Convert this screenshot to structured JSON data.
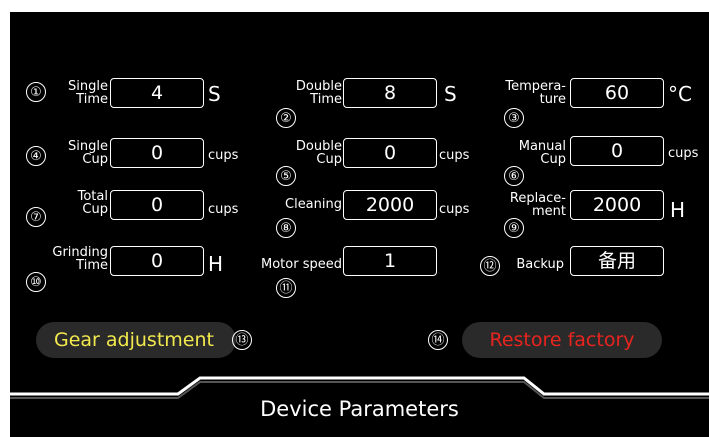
{
  "params": [
    {
      "num": "①",
      "label": [
        "Single",
        "Time"
      ],
      "value": "4",
      "unit": "S"
    },
    {
      "num": "②",
      "label": [
        "Double",
        "Time"
      ],
      "value": "8",
      "unit": "S"
    },
    {
      "num": "③",
      "label": [
        "Tempera-",
        "ture"
      ],
      "value": "60",
      "unit": "°C"
    },
    {
      "num": "④",
      "label": [
        "Single",
        "Cup"
      ],
      "value": "0",
      "unit": "cups"
    },
    {
      "num": "⑤",
      "label": [
        "Double",
        "Cup"
      ],
      "value": "0",
      "unit": "cups"
    },
    {
      "num": "⑥",
      "label": [
        "Manual",
        "Cup"
      ],
      "value": "0",
      "unit": "cups"
    },
    {
      "num": "⑦",
      "label": [
        "Total",
        "Cup"
      ],
      "value": "0",
      "unit": "cups"
    },
    {
      "num": "⑧",
      "label": [
        "Cleaning"
      ],
      "value": "2000",
      "unit": "cups"
    },
    {
      "num": "⑨",
      "label": [
        "Replace-",
        "ment"
      ],
      "value": "2000",
      "unit": "H"
    },
    {
      "num": "⑩",
      "label": [
        "Grinding",
        "Time"
      ],
      "value": "0",
      "unit": "H"
    },
    {
      "num": "⑪",
      "label": [
        "Motor speed"
      ],
      "value": "1",
      "unit": ""
    },
    {
      "num": "⑫",
      "label": [
        "Backup"
      ],
      "value": "备用",
      "unit": ""
    }
  ],
  "buttons": {
    "gear": {
      "label": "Gear adjustment",
      "num": "⑬",
      "color": "#f2e94e"
    },
    "restore": {
      "label": "Restore factory",
      "num": "⑭",
      "color": "#e8241e"
    }
  },
  "footer": {
    "title": "Device Parameters"
  }
}
